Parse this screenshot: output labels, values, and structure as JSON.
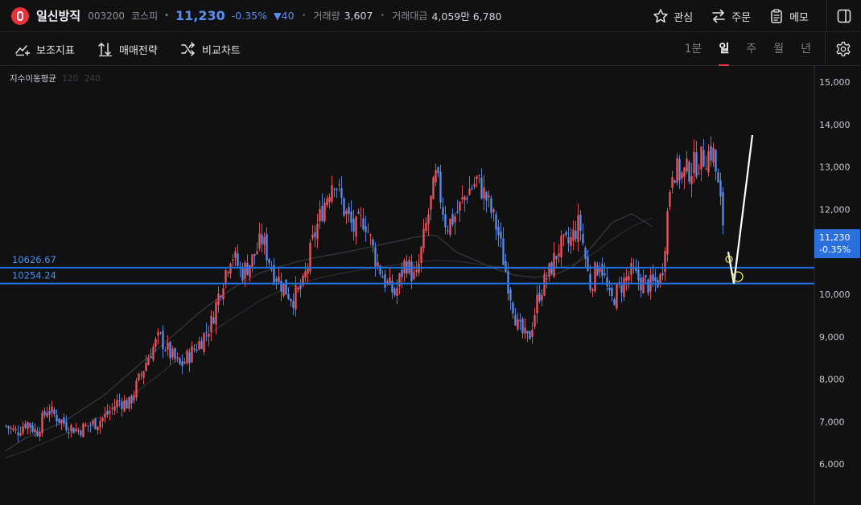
{
  "stock": {
    "name": "일신방직",
    "code": "003200",
    "market": "코스피",
    "price": "11,230",
    "change_rate": "-0.35%",
    "change_diff": "▼40",
    "volume_label": "거래량",
    "volume": "3,607",
    "amount_label": "거래대금",
    "amount": "4,059만 6,780"
  },
  "header_actions": {
    "interest": "관심",
    "order": "주문",
    "memo": "메모"
  },
  "toolbar": {
    "indicators": "보조지표",
    "strategy": "매매전략",
    "compare": "비교차트",
    "periods": [
      "1분",
      "일",
      "주",
      "월",
      "년"
    ],
    "active_period": "일"
  },
  "legend": {
    "title": "지수이동평균",
    "values": [
      "120",
      "240"
    ]
  },
  "colors": {
    "up": "#f0555f",
    "down": "#5b8def",
    "hline": "#1e6fe0",
    "drawing_white": "#ffffff",
    "drawing_circle": "#e8e86a"
  },
  "chart_data": {
    "type": "candlestick",
    "y_axis_ticks": [
      "15,000",
      "14,000",
      "13,000",
      "12,000",
      "11,000",
      "10,000",
      "9,000",
      "8,000",
      "7,000",
      "6,000"
    ],
    "ylim": [
      5000,
      15300
    ],
    "price_tag": {
      "value": 11230,
      "label": "11,230",
      "rate": "-0.35%"
    },
    "horizontal_lines": [
      {
        "value": 10626.67,
        "label": "10626.67"
      },
      {
        "value": 10254.24,
        "label": "10254.24"
      }
    ],
    "drawing": {
      "polyline": [
        [
          11000,
          0
        ],
        [
          10254,
          7
        ],
        [
          13750,
          30
        ]
      ],
      "circles": [
        10826,
        10415
      ]
    },
    "close_path": [
      6900,
      6750,
      7000,
      6750,
      7300,
      7100,
      6900,
      6800,
      6900,
      7000,
      7200,
      7500,
      7400,
      8000,
      8600,
      9000,
      8600,
      8300,
      8600,
      8900,
      9300,
      10200,
      11000,
      10500,
      10800,
      11300,
      10600,
      10200,
      9900,
      10200,
      11300,
      12100,
      12800,
      12000,
      11500,
      11800,
      10900,
      10300,
      10000,
      10800,
      10300,
      11600,
      12800,
      11600,
      11900,
      12400,
      12700,
      12200,
      11500,
      10300,
      9200,
      8900,
      10000,
      10500,
      11100,
      11200,
      11700,
      10200,
      10800,
      9800,
      10200,
      10500,
      10300,
      10200,
      10400,
      13000,
      12800,
      13000,
      13200,
      13400,
      11700
    ],
    "ema120": [
      6300,
      6600,
      6800,
      7000,
      7300,
      7600,
      8000,
      8400,
      8800,
      9200,
      9600,
      9950,
      10250,
      10500,
      10650,
      10780,
      10880,
      10960,
      11050,
      11150,
      11250,
      11350,
      11400,
      11000,
      10800,
      10600,
      10450,
      10400,
      10450,
      10650,
      11150,
      11700,
      11900,
      11600
    ],
    "ema240": [
      6150,
      6300,
      6500,
      6700,
      6900,
      7150,
      7450,
      7800,
      8150,
      8550,
      8900,
      9250,
      9550,
      9850,
      10080,
      10250,
      10380,
      10480,
      10560,
      10630,
      10700,
      10760,
      10800,
      10780,
      10720,
      10660,
      10600,
      10580,
      10600,
      10700,
      10950,
      11300,
      11600,
      11800
    ]
  }
}
